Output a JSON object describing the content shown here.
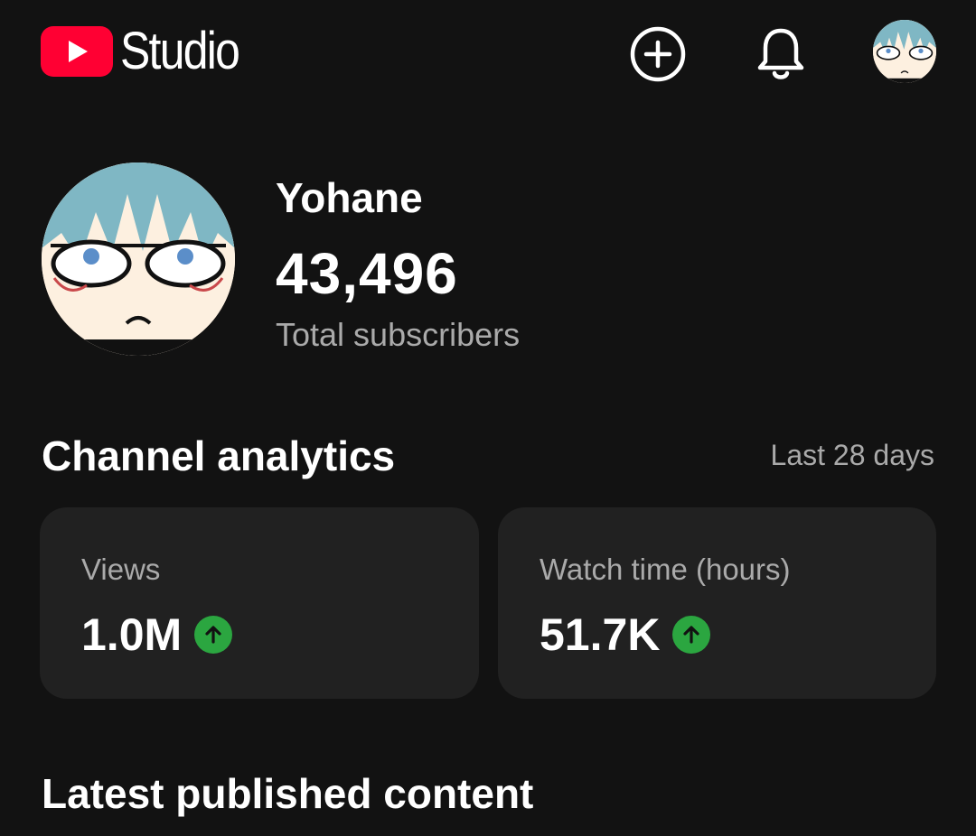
{
  "header": {
    "logo_text": "Studio",
    "brand_color": "#ff0033",
    "create_icon": "add-circle-icon",
    "notifications_icon": "bell-icon"
  },
  "channel": {
    "name": "Yohane",
    "subscriber_count": "43,496",
    "subscriber_label": "Total subscribers"
  },
  "analytics": {
    "title": "Channel analytics",
    "period": "Last 28 days",
    "cards": [
      {
        "label": "Views",
        "value": "1.0M",
        "trend": "up",
        "trend_color": "#2ba640"
      },
      {
        "label": "Watch time (hours)",
        "value": "51.7K",
        "trend": "up",
        "trend_color": "#2ba640"
      }
    ]
  },
  "latest": {
    "title": "Latest published content"
  }
}
